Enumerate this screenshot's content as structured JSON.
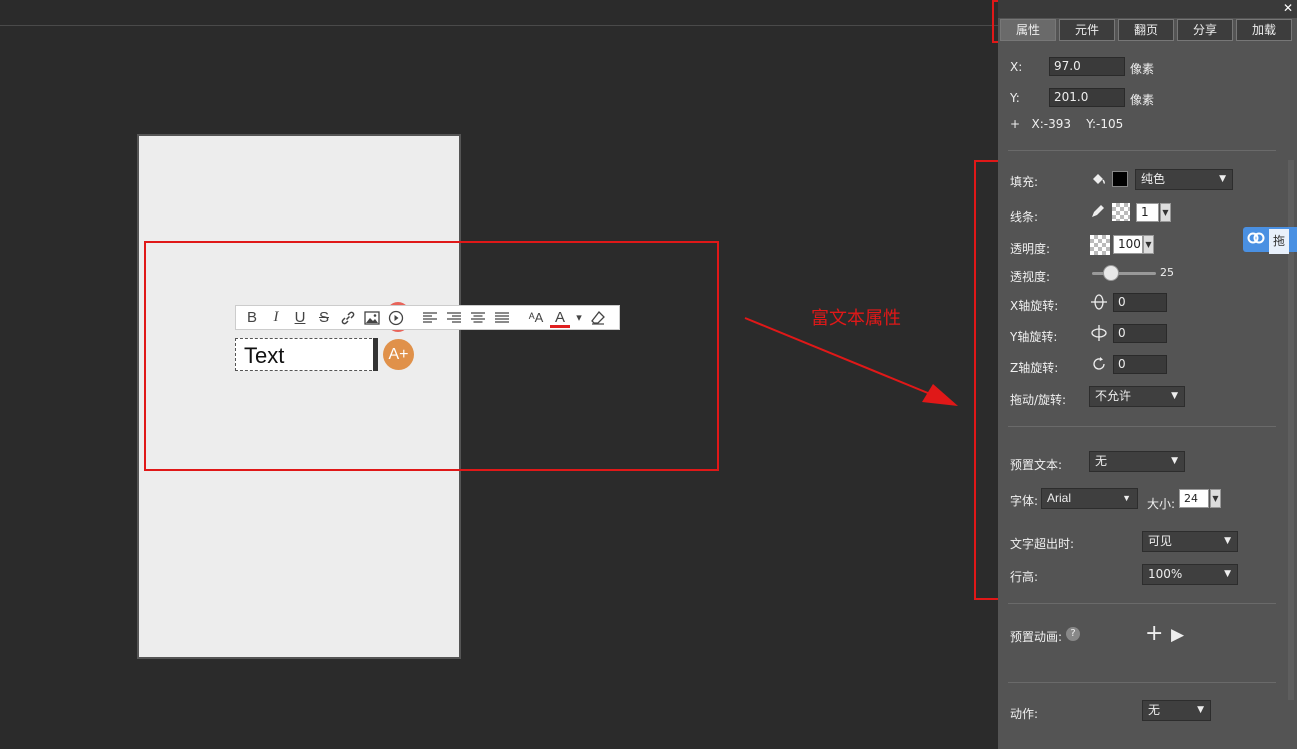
{
  "toolbar": {
    "bold": "B",
    "italic": "I",
    "underline": "U",
    "strike": "S",
    "link_icon": "link-icon",
    "image_icon": "image-icon",
    "play_icon": "play-icon",
    "font_size_icon": "ᴬA",
    "font_color": "A",
    "caret": "▾",
    "eraser_icon": "eraser-icon"
  },
  "canvas": {
    "text_box": "Text",
    "font_badge": "A+"
  },
  "annotation": {
    "label": "富文本属性",
    "color": "#e01818"
  },
  "panel": {
    "close": "✕",
    "tabs": [
      "属性",
      "元件",
      "翻页",
      "分享",
      "加载"
    ],
    "x_label": "X:",
    "x_value": "97.0",
    "x_unit": "像素",
    "y_label": "Y:",
    "y_value": "201.0",
    "y_unit": "像素",
    "coords": "+   X:-393    Y:-105",
    "fill_label": "填充:",
    "fill_mode": "纯色",
    "fill_color": "#000000",
    "stroke_label": "线条:",
    "stroke_width": "1",
    "opacity_label": "透明度:",
    "opacity_value": "100",
    "perspective_label": "透视度:",
    "perspective_value": "25",
    "xrot_label": "X轴旋转:",
    "xrot_value": "0",
    "yrot_label": "Y轴旋转:",
    "yrot_value": "0",
    "zrot_label": "Z轴旋转:",
    "zrot_value": "0",
    "drag_label": "拖动/旋转:",
    "drag_value": "不允许",
    "preset_text_label": "预置文本:",
    "preset_text_value": "无",
    "font_label": "字体:",
    "font_value": "Arial",
    "size_label": "大小:",
    "size_value": "24",
    "overflow_label": "文字超出时:",
    "overflow_value": "可见",
    "lineheight_label": "行高:",
    "lineheight_value": "100%",
    "preset_anim_label": "预置动画:",
    "help": "?",
    "add": "+",
    "play": "▶",
    "action_label": "动作:",
    "action_value": "无"
  },
  "ext_tag": {
    "text": "拖"
  }
}
